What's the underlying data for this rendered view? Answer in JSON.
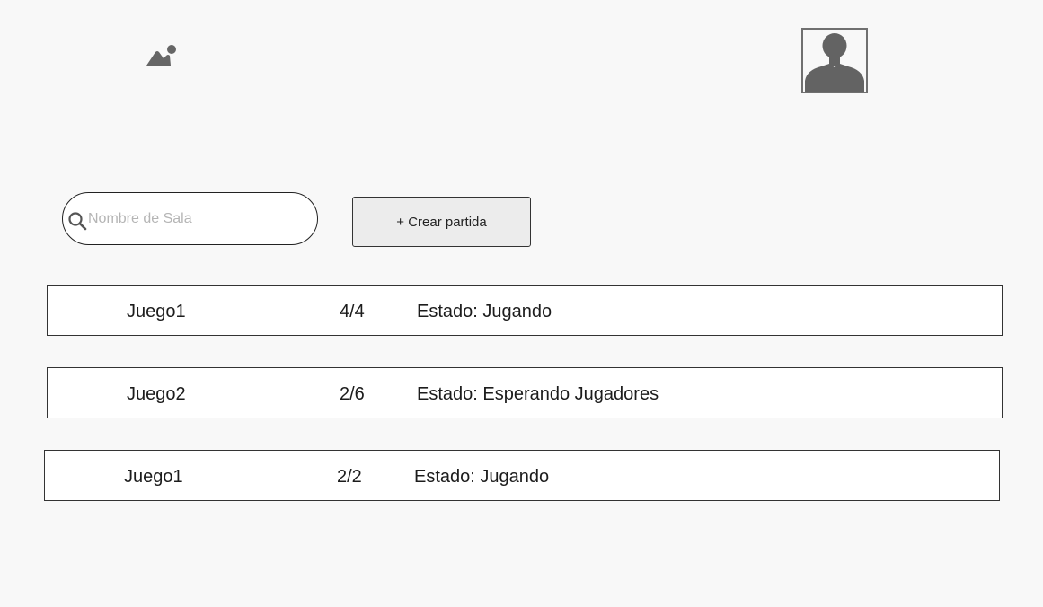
{
  "header": {
    "logo_icon": "image-placeholder-icon",
    "avatar_icon": "user-silhouette-icon"
  },
  "search": {
    "placeholder": "Nombre de Sala",
    "value": "",
    "icon": "search-icon"
  },
  "create_button": {
    "label": "+ Crear partida"
  },
  "games": [
    {
      "name": "Juego1",
      "players": "4/4",
      "status": "Estado: Jugando"
    },
    {
      "name": "Juego2",
      "players": "2/6",
      "status": "Estado: Esperando Jugadores"
    },
    {
      "name": "Juego1",
      "players": "2/2",
      "status": "Estado: Jugando"
    }
  ],
  "colors": {
    "background": "#f8f8f8",
    "button_bg": "#ececec",
    "icon_gray": "#666666",
    "border": "#333333"
  }
}
